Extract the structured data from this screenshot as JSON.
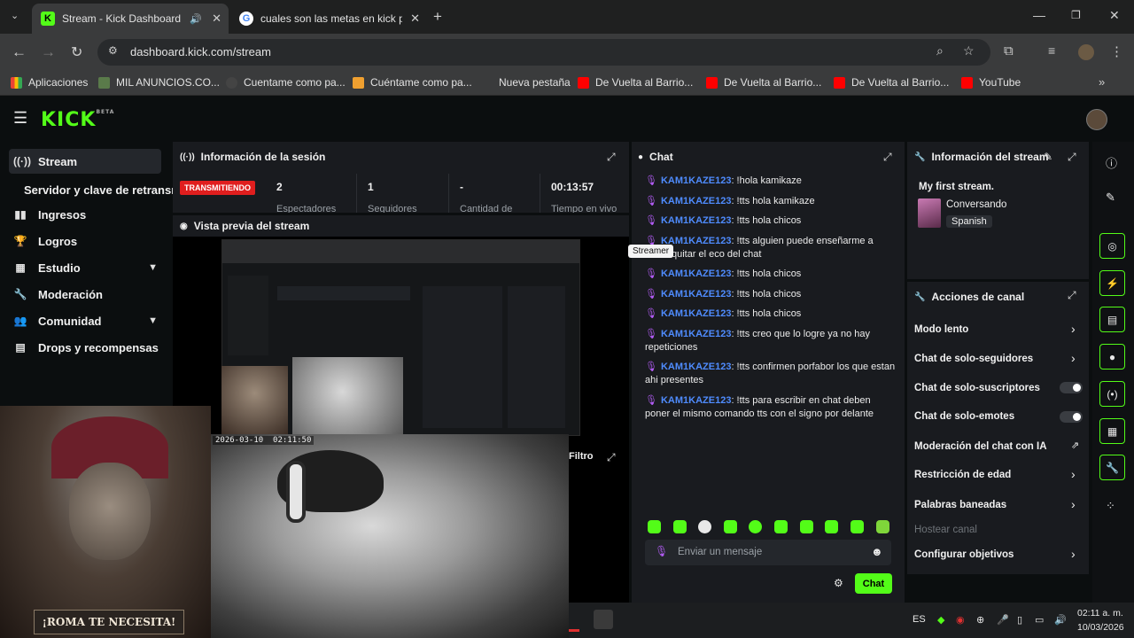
{
  "browser": {
    "tabs": [
      {
        "title": "Stream - Kick Dashboard",
        "active": true
      },
      {
        "title": "cuales son las metas en kick pa",
        "active": false
      }
    ],
    "url": "dashboard.kick.com/stream",
    "bookmarks": [
      "Aplicaciones",
      "MIL ANUNCIOS.CO...",
      "Cuentame como pa...",
      "Cuéntame como pa...",
      "Nueva pestaña",
      "De Vuelta al Barrio...",
      "De Vuelta al Barrio...",
      "De Vuelta al Barrio...",
      "YouTube"
    ]
  },
  "brand": {
    "accent": "#53fc18",
    "username_color": "#4f8cff",
    "live_badge": "#e01e1e"
  },
  "sidebar": {
    "items": [
      {
        "label": "Stream",
        "icon": "broadcast-icon"
      },
      {
        "label": "Servidor y clave de retransm",
        "icon": ""
      },
      {
        "label": "Ingresos",
        "icon": "bars-icon"
      },
      {
        "label": "Logros",
        "icon": "trophy-icon"
      },
      {
        "label": "Estudio",
        "icon": "grid-icon"
      },
      {
        "label": "Moderación",
        "icon": "wrench-icon"
      },
      {
        "label": "Comunidad",
        "icon": "users-icon"
      },
      {
        "label": "Drops y recompensas",
        "icon": "gift-icon"
      }
    ]
  },
  "session": {
    "title": "Información de la sesión",
    "status": "TRANSMITIENDO",
    "viewers": "2",
    "viewers_label": "Espectadores",
    "followers": "1",
    "followers_label": "Seguidores",
    "amount": "-",
    "amount_label": "Cantidad de",
    "time": "00:13:57",
    "time_label": "Tiempo en vivo"
  },
  "preview": {
    "title": "Vista previa del stream",
    "filter_label": "Filtro"
  },
  "webcam": {
    "timestamp": "2026-03-10  02:11:50",
    "poster_text": "¡ROMA TE NECESITA!"
  },
  "chat": {
    "title": "Chat",
    "tooltip": "Streamer",
    "messages": [
      {
        "user": "KAM1KAZE123",
        "text": ": !hola kamikaze"
      },
      {
        "user": "KAM1KAZE123",
        "text": ": !tts hola kamikaze"
      },
      {
        "user": "KAM1KAZE123",
        "text": ": !tts hola chicos"
      },
      {
        "user": "KAM1KAZE123",
        "text": ": !tts alguien puede enseñarme a como quitar el eco del chat"
      },
      {
        "user": "KAM1KAZE123",
        "text": ": !tts hola chicos"
      },
      {
        "user": "KAM1KAZE123",
        "text": ": !tts hola chicos"
      },
      {
        "user": "KAM1KAZE123",
        "text": ": !tts hola chicos"
      },
      {
        "user": "KAM1KAZE123",
        "text": ": !tts creo que lo logre ya no hay repeticiones"
      },
      {
        "user": "KAM1KAZE123",
        "text": ": !tts confirmen porfabor los que estan ahi presentes"
      },
      {
        "user": "KAM1KAZE123",
        "text": ": !tts para escribir en chat deben poner el mismo comando tts con el signo por delante"
      }
    ],
    "input_placeholder": "Enviar un mensaje",
    "send_label": "Chat"
  },
  "stream_info": {
    "title": "Información del stream",
    "stream_title": "My first stream.",
    "category": "Conversando",
    "language": "Spanish"
  },
  "channel_actions": {
    "title": "Acciones de canal",
    "items": [
      {
        "label": "Modo lento",
        "control": "arrow"
      },
      {
        "label": "Chat de solo-seguidores",
        "control": "arrow"
      },
      {
        "label": "Chat de solo-suscriptores",
        "control": "toggle"
      },
      {
        "label": "Chat de solo-emotes",
        "control": "toggle"
      },
      {
        "label": "Moderación del chat con IA",
        "control": "external"
      },
      {
        "label": "Restricción de edad",
        "control": "arrow"
      },
      {
        "label": "Palabras baneadas",
        "control": "arrow"
      },
      {
        "label": "Hostear canal",
        "control": "disabled"
      },
      {
        "label": "Configurar objetivos",
        "control": "arrow"
      }
    ]
  },
  "taskbar": {
    "language": "ES",
    "time": "02:11 a. m.",
    "date": "10/03/2026"
  }
}
